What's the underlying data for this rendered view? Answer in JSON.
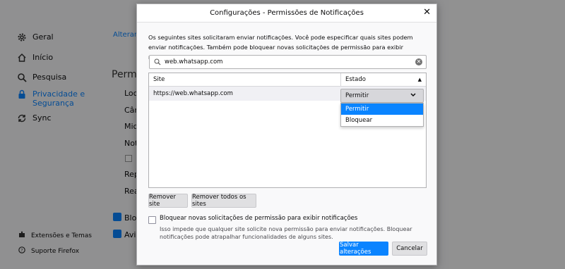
{
  "background": {
    "sidebar": [
      {
        "label": "Geral",
        "icon": "gear-icon"
      },
      {
        "label": "Início",
        "icon": "home-icon"
      },
      {
        "label": "Pesquisa",
        "icon": "search-icon"
      },
      {
        "label": "Privacidade e Segurança",
        "line1": "Privacidade e",
        "line2": "Segurança",
        "icon": "lock-icon",
        "active": true
      },
      {
        "label": "Sync",
        "icon": "sync-icon"
      }
    ],
    "footer": [
      {
        "label": "Extensões e Temas",
        "icon": "puzzle-icon"
      },
      {
        "label": "Suporte Firefox",
        "icon": "help-icon"
      }
    ],
    "alterar": "Alterar p",
    "permissions_heading": "Permiss",
    "perm_items": [
      "Loca",
      "Câm",
      "Micr",
      "Noti",
      "Rep",
      "Real",
      "Bloq",
      "Avis"
    ]
  },
  "dialog": {
    "title": "Configurações - Permissões de Notificações",
    "description": "Os seguintes sites solicitaram enviar notificações. Você pode especificar quais sites podem enviar notificações. Também pode bloquear novas solicitações de permissão para exibir notificações.",
    "search": {
      "value": "web.whatsapp.com"
    },
    "table": {
      "columns": [
        "Site",
        "Estado"
      ],
      "rows": [
        {
          "site": "https://web.whatsapp.com",
          "state": "Permitir"
        }
      ]
    },
    "dropdown_options": [
      "Permitir",
      "Bloquear"
    ],
    "buttons": {
      "remove_site": "Remover site",
      "remove_all": "Remover todos os sites",
      "save": "Salvar alterações",
      "cancel": "Cancelar"
    },
    "block_checkbox_label": "Bloquear novas solicitações de permissão para exibir notificações",
    "block_note": "Isso impede que qualquer site solicite nova permissão para enviar notificações. Bloquear notificações pode atrapalhar funcionalidades de alguns sites.",
    "colors": {
      "accent": "#0a84ff"
    }
  }
}
